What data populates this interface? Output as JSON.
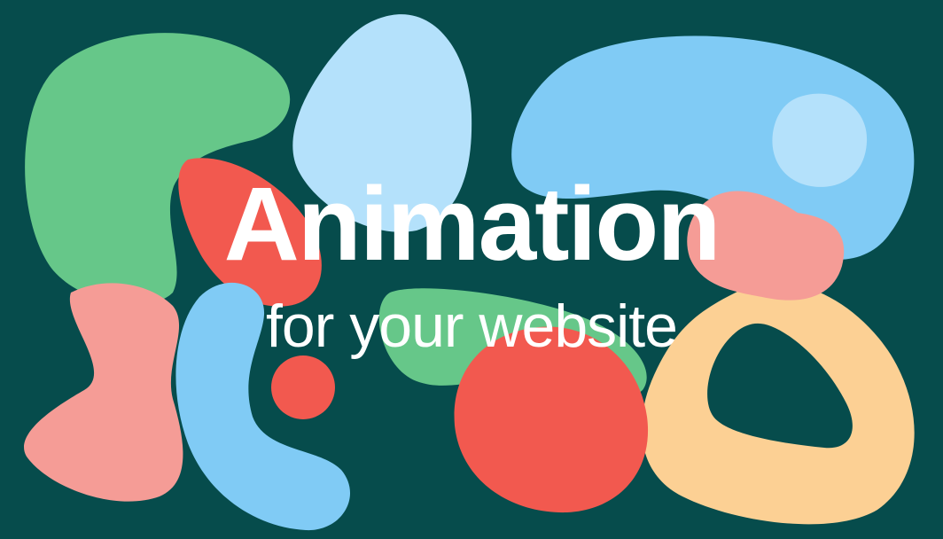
{
  "hero": {
    "headline": "Animation",
    "subline": "for your website"
  },
  "colors": {
    "background": "#064c4c",
    "green": "#66c789",
    "light_blue": "#b4e1fb",
    "blue": "#80cbf5",
    "red": "#f2594f",
    "pink": "#f59c96",
    "peach": "#fcd094",
    "text": "#ffffff"
  }
}
